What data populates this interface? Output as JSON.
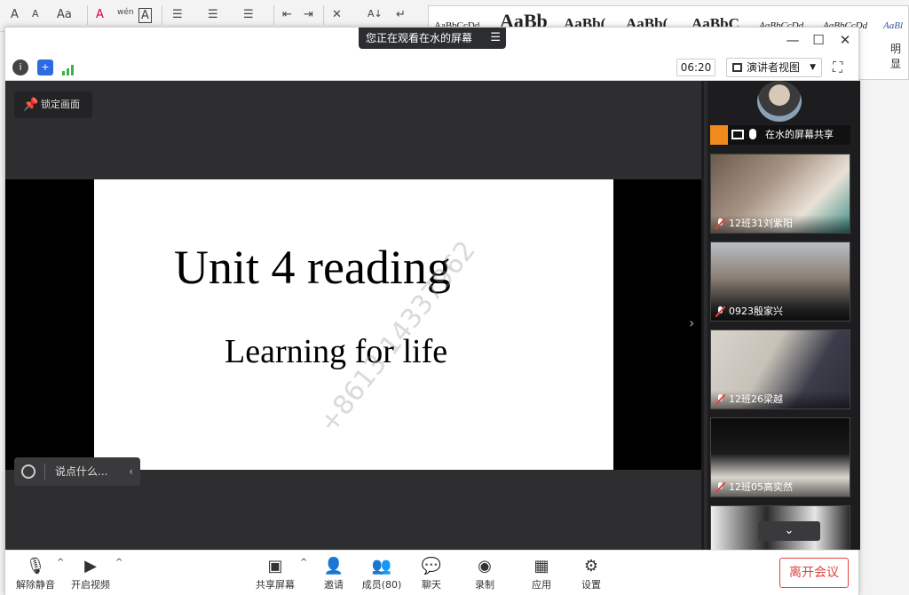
{
  "word": {
    "toolbar_glyphs": [
      "A",
      "A",
      "Aa",
      "A",
      "wén",
      "A",
      "☰",
      "☰",
      "☰",
      "⇤",
      "⇥",
      "✕",
      "A↓",
      "↵"
    ],
    "styles": [
      "AaBbCcDd",
      "AaBb",
      "AaBb(",
      "AaBb(",
      "AaBbC",
      "AaBbCcDd",
      "AaBbCcDd",
      "AaBl"
    ],
    "side_label": "明显"
  },
  "meeting": {
    "banner": "您正在观看在水的屏幕",
    "window_controls": {
      "minimize": "—",
      "maximize": "☐",
      "close": "✕"
    },
    "timer": "06:20",
    "view_button": "演讲者视图",
    "lock_label": "锁定画面",
    "chat_placeholder": "说点什么...",
    "slide": {
      "title": "Unit 4 reading",
      "subtitle": "Learning for life",
      "watermark": "+8613 14337962"
    },
    "host": {
      "label": "在水的屏幕共享"
    },
    "participants": [
      {
        "name": "12班31刘紫阳"
      },
      {
        "name": "0923殷家兴"
      },
      {
        "name": "12班26梁越"
      },
      {
        "name": "12班05高奕然"
      }
    ],
    "toolbar": {
      "unmute": "解除静音",
      "start_video": "开启视频",
      "share_screen": "共享屏幕",
      "invite": "邀请",
      "members": "成员(80)",
      "chat": "聊天",
      "record": "录制",
      "apps": "应用",
      "settings": "设置",
      "leave": "离开会议"
    },
    "colors": {
      "accent": "#e0433c",
      "share_bg": "#2e2e30",
      "host_badge": "#f08a1c"
    }
  }
}
